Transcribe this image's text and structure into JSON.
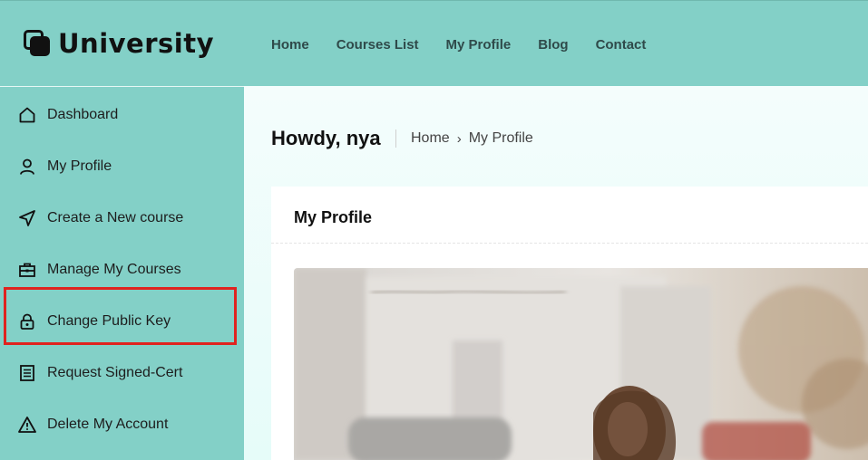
{
  "header": {
    "brand": "University",
    "nav": [
      "Home",
      "Courses List",
      "My Profile",
      "Blog",
      "Contact"
    ]
  },
  "sidebar": {
    "items": [
      {
        "label": "Dashboard",
        "icon": "home-icon"
      },
      {
        "label": "My Profile",
        "icon": "user-icon"
      },
      {
        "label": "Create a New course",
        "icon": "send-icon"
      },
      {
        "label": "Manage My Courses",
        "icon": "briefcase-icon"
      },
      {
        "label": "Change Public Key",
        "icon": "lock-icon"
      },
      {
        "label": "Request Signed-Cert",
        "icon": "document-icon"
      },
      {
        "label": "Delete My Account",
        "icon": "warning-icon"
      }
    ]
  },
  "main": {
    "greeting": "Howdy, nya",
    "breadcrumb": {
      "home": "Home",
      "separator": "›",
      "current": "My Profile"
    },
    "card_title": "My Profile"
  },
  "colors": {
    "teal": "#83d0c7",
    "highlight": "#e0231f"
  }
}
